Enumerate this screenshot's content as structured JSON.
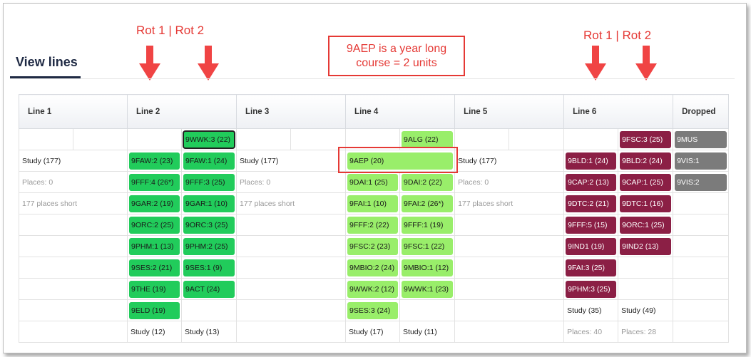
{
  "tab": {
    "title": "View lines"
  },
  "annotations": {
    "rot_left": "Rot 1  |  Rot 2",
    "rot_right": "Rot 1  |  Rot 2",
    "note_line1": "9AEP is a year long",
    "note_line2": "course = 2 units"
  },
  "headers": [
    "Line 1",
    "Line 2",
    "Line 3",
    "Line 4",
    "Line 5",
    "Line 6",
    "Dropped"
  ],
  "line1": {
    "study": "Study (177)",
    "places": "Places: 0",
    "short": "177 places short"
  },
  "line3": {
    "study": "Study (177)",
    "places": "Places: 0",
    "short": "177 places short"
  },
  "line5": {
    "study": "Study (177)",
    "places": "Places: 0",
    "short": "177 places short"
  },
  "line2": {
    "rot1": [
      "9FAW:2 (23)",
      "9FFF:4 (26*)",
      "9GAR:2 (19)",
      "9ORC:2 (25)",
      "9PHM:1 (13)",
      "9SES:2 (21)",
      "9THE (19)",
      "9ELD (19)"
    ],
    "rot2": [
      "9WWK:3 (22)",
      "9FAW:1 (24)",
      "9FFF:3 (25)",
      "9GAR:1 (10)",
      "9ORC:3 (25)",
      "9PHM:2 (25)",
      "9SES:1 (9)",
      "9ACT (24)"
    ],
    "study1": "Study (12)",
    "study2": "Study (13)"
  },
  "line4": {
    "top": "9ALG (22)",
    "aep": "9AEP (20)",
    "rot1": [
      "9DAI:1 (25)",
      "9FAI:1 (10)",
      "9FFF:2 (22)",
      "9FSC:2 (23)",
      "9MBIO:2 (24)",
      "9WWK:2 (12)",
      "9SES:3 (24)"
    ],
    "rot2": [
      "9DAI:2 (22)",
      "9FAI:2 (26*)",
      "9FFF:1 (19)",
      "9FSC:1 (22)",
      "9MBIO:1 (12)",
      "9WWK:1 (23)"
    ],
    "study1": "Study (17)",
    "study2": "Study (11)"
  },
  "line6": {
    "top": "9FSC:3 (25)",
    "rot1": [
      "9BLD:1 (24)",
      "9CAP:2 (13)",
      "9DTC:2 (21)",
      "9FFF:5 (15)",
      "9IND1 (19)",
      "9FAI:3 (25)",
      "9PHM:3 (25)"
    ],
    "rot2": [
      "9BLD:2 (24)",
      "9CAP:1 (25)",
      "9DTC:1 (16)",
      "9ORC:1 (25)",
      "9IND2 (13)"
    ],
    "study1": "Study (35)",
    "study2": "Study (49)",
    "places1": "Places: 40",
    "places2": "Places: 28"
  },
  "dropped": [
    "9MUS",
    "9VIS:1",
    "9VIS:2"
  ],
  "colors": {
    "green": "#21cc5b",
    "lime": "#99ee6a",
    "maroon": "#8b1f45",
    "grey": "#7b7b7b",
    "annotation": "#e53935"
  }
}
